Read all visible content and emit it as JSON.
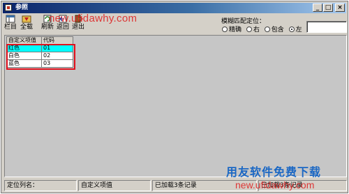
{
  "window": {
    "title": "参照"
  },
  "window_controls": {
    "minimize": "_",
    "maximize": "□",
    "close": "×"
  },
  "toolbar": {
    "column_label": "栏目",
    "loadall_label": "全载",
    "refresh_label": "刷新",
    "return_label": "返回",
    "exit_label": "退出"
  },
  "fuzzy_match": {
    "label": "模糊匹配定位：",
    "options": [
      {
        "label": "精确",
        "selected": false
      },
      {
        "label": "右",
        "selected": false
      },
      {
        "label": "包含",
        "selected": false
      },
      {
        "label": "左",
        "selected": true
      }
    ],
    "input_value": ""
  },
  "grid": {
    "columns": [
      "自定义项值",
      "代码"
    ],
    "rows": [
      {
        "name": "红色",
        "code": "01",
        "selected": true
      },
      {
        "name": "白色",
        "code": "02",
        "selected": false
      },
      {
        "name": "蓝色",
        "code": "03",
        "selected": false
      }
    ]
  },
  "status_bar": {
    "locate_column_label": "定位列名：",
    "custom_value": "自定义项值",
    "loaded_count": "已加载3条记录",
    "extra": "已加载3条记录"
  },
  "watermarks": {
    "top": "new.ufidawhy.com",
    "brand": "用友软件免费下载",
    "bottom": "new.ufidawhy.com"
  },
  "colors": {
    "highlight": "#00ffff",
    "annotation_box": "#e0101c",
    "title_bar": "#0a246a"
  }
}
